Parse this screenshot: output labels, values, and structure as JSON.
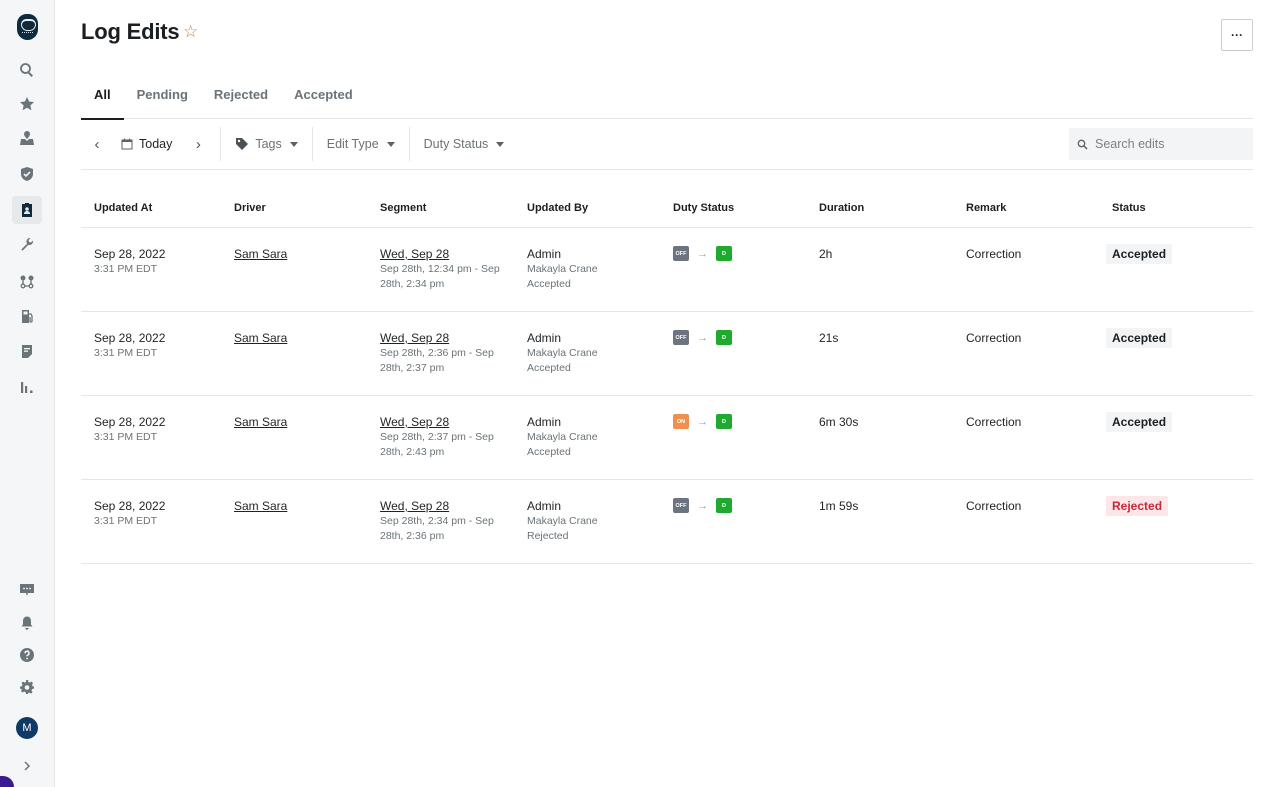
{
  "sidebar": {
    "logo": "owl-logo",
    "top_items": [
      {
        "icon": "search-icon",
        "active": false
      },
      {
        "icon": "star-icon",
        "active": false
      },
      {
        "icon": "map-pin-icon",
        "active": false
      },
      {
        "icon": "shield-check-icon",
        "active": false
      },
      {
        "icon": "id-badge-icon",
        "active": true
      },
      {
        "icon": "wrench-icon",
        "active": false
      },
      {
        "icon": "route-icon",
        "active": false
      },
      {
        "icon": "fuel-icon",
        "active": false
      },
      {
        "icon": "document-icon",
        "active": false
      },
      {
        "icon": "bar-chart-icon",
        "active": false
      }
    ],
    "bottom_items": [
      {
        "icon": "chat-icon"
      },
      {
        "icon": "bell-icon"
      },
      {
        "icon": "help-icon"
      },
      {
        "icon": "gear-icon"
      }
    ],
    "avatar_initial": "M",
    "expand_icon": "chevron-right-icon"
  },
  "header": {
    "title": "Log Edits",
    "favorite_icon": "☆",
    "more_label": "···"
  },
  "tabs": [
    {
      "label": "All",
      "active": true
    },
    {
      "label": "Pending",
      "active": false
    },
    {
      "label": "Rejected",
      "active": false
    },
    {
      "label": "Accepted",
      "active": false
    }
  ],
  "toolbar": {
    "prev_icon": "‹",
    "next_icon": "›",
    "date_label": "Today",
    "tags_label": "Tags",
    "edit_type_label": "Edit Type",
    "duty_status_label": "Duty Status",
    "search_placeholder": "Search edits",
    "search_value": ""
  },
  "table": {
    "columns": [
      "Updated At",
      "Driver",
      "Segment",
      "Updated By",
      "Duty Status",
      "Duration",
      "Remark",
      "Status"
    ],
    "colors": {
      "OFF": "#6b7480",
      "ON": "#f0904f",
      "D": "#1eaa2d",
      "accepted_bg": "#f3f4f5",
      "accepted_fg": "#1b1f22",
      "rejected_bg": "#fde6e8",
      "rejected_fg": "#c42a3a"
    },
    "rows": [
      {
        "date": "Sep 28, 2022",
        "time": "3:31 PM EDT",
        "driver": "Sam Sara",
        "segment_day": "Wed, Sep 28",
        "segment_range": "Sep 28th, 12:34 pm - Sep 28th, 2:34 pm",
        "updated_by": "Admin",
        "updated_by_name": "Makayla Crane",
        "updated_by_result": "Accepted",
        "from_status": "OFF",
        "to_status": "D",
        "arrow": "→",
        "duration": "2h",
        "remark": "Correction",
        "status": "Accepted"
      },
      {
        "date": "Sep 28, 2022",
        "time": "3:31 PM EDT",
        "driver": "Sam Sara",
        "segment_day": "Wed, Sep 28",
        "segment_range": "Sep 28th, 2:36 pm - Sep 28th, 2:37 pm",
        "updated_by": "Admin",
        "updated_by_name": "Makayla Crane",
        "updated_by_result": "Accepted",
        "from_status": "OFF",
        "to_status": "D",
        "arrow": "→",
        "duration": "21s",
        "remark": "Correction",
        "status": "Accepted"
      },
      {
        "date": "Sep 28, 2022",
        "time": "3:31 PM EDT",
        "driver": "Sam Sara",
        "segment_day": "Wed, Sep 28",
        "segment_range": "Sep 28th, 2:37 pm - Sep 28th, 2:43 pm",
        "updated_by": "Admin",
        "updated_by_name": "Makayla Crane",
        "updated_by_result": "Accepted",
        "from_status": "ON",
        "to_status": "D",
        "arrow": "→",
        "duration": "6m 30s",
        "remark": "Correction",
        "status": "Accepted"
      },
      {
        "date": "Sep 28, 2022",
        "time": "3:31 PM EDT",
        "driver": "Sam Sara",
        "segment_day": "Wed, Sep 28",
        "segment_range": "Sep 28th, 2:34 pm - Sep 28th, 2:36 pm",
        "updated_by": "Admin",
        "updated_by_name": "Makayla Crane",
        "updated_by_result": "Rejected",
        "from_status": "OFF",
        "to_status": "D",
        "arrow": "→",
        "duration": "1m 59s",
        "remark": "Correction",
        "status": "Rejected"
      }
    ]
  }
}
